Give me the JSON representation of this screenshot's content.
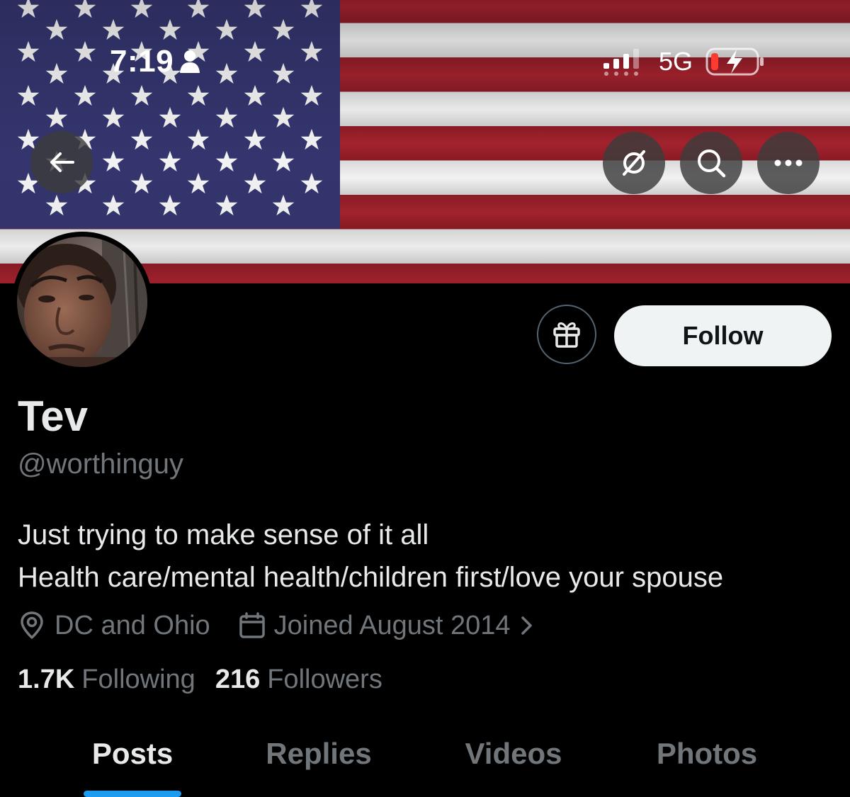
{
  "status_bar": {
    "time": "7:19",
    "network": "5G",
    "icons": [
      "person-icon",
      "signal-icon",
      "battery-charging-icon"
    ]
  },
  "header": {
    "back_icon": "arrow-left-icon",
    "actions": [
      "grok-icon",
      "search-icon",
      "more-icon"
    ]
  },
  "profile": {
    "display_name": "Tev",
    "handle": "@worthinguy",
    "bio_lines": [
      "Just trying to make sense of it all",
      "Health care/mental health/children first/love your spouse"
    ],
    "location": "DC and Ohio",
    "joined": "Joined August 2014",
    "following_count": "1.7K",
    "following_label": "Following",
    "followers_count": "216",
    "followers_label": "Followers"
  },
  "actions": {
    "follow_label": "Follow",
    "gift_icon": "gift-icon"
  },
  "tabs": [
    {
      "label": "Posts",
      "active": true
    },
    {
      "label": "Replies",
      "active": false
    },
    {
      "label": "Videos",
      "active": false
    },
    {
      "label": "Photos",
      "active": false
    }
  ],
  "colors": {
    "accent": "#1d9bf0",
    "flag_red": "#a21f2a",
    "flag_blue": "#34356e",
    "muted_text": "#71767b",
    "follow_button": "#eff3f4"
  }
}
